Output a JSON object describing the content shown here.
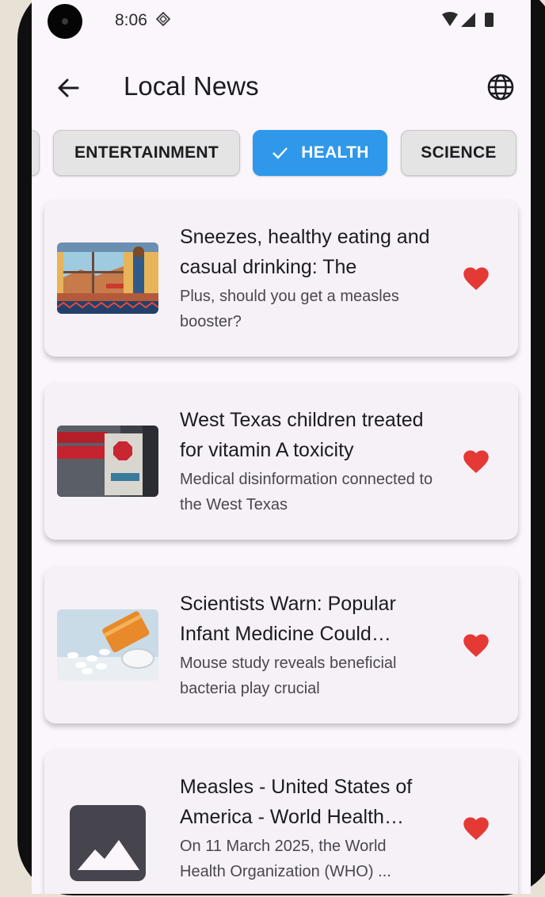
{
  "status_bar": {
    "time": "8:06"
  },
  "app_bar": {
    "title": "Local News"
  },
  "categories": [
    {
      "label": "ENTERTAINMENT",
      "selected": false
    },
    {
      "label": "HEALTH",
      "selected": true
    },
    {
      "label": "SCIENCE",
      "selected": false
    }
  ],
  "articles": [
    {
      "title": "Sneezes, healthy eating and casual drinking: The",
      "subtitle": "Plus, should you get a measles booster?",
      "favorited": true,
      "thumbnail": "illustration-window-scene"
    },
    {
      "title": "West Texas children treated for vitamin A toxicity",
      "subtitle": "Medical disinformation connected to the West Texas",
      "favorited": true,
      "thumbnail": "emergency-sign-photo"
    },
    {
      "title": "Scientists Warn: Popular Infant Medicine Could Trigger",
      "subtitle": "Mouse study reveals beneficial bacteria play crucial",
      "favorited": true,
      "thumbnail": "pill-bottle-photo"
    },
    {
      "title": "Measles - United States of America - World Health Organization",
      "subtitle": "On 11 March 2025, the World Health Organization (WHO) ...",
      "favorited": true,
      "thumbnail": "image-placeholder-icon"
    }
  ],
  "colors": {
    "accent": "#2f98ea",
    "heart": "#e53935",
    "background": "#fbf6fc"
  }
}
